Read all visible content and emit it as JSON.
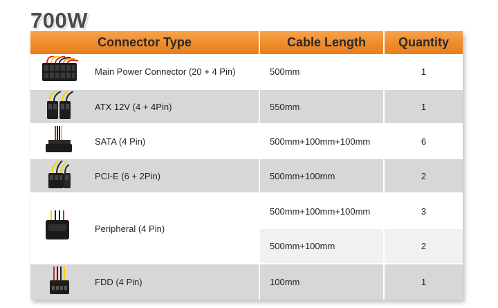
{
  "title": "700W",
  "headers": {
    "connector_type": "Connector Type",
    "cable_length": "Cable Length",
    "quantity": "Quantity"
  },
  "rows": [
    {
      "connector": "Main Power Connector (20 + 4 Pin)",
      "icon": "main-power-connector-icon",
      "lengths": [
        {
          "length": "500mm",
          "qty": "1"
        }
      ]
    },
    {
      "connector": "ATX 12V (4 + 4Pin)",
      "icon": "atx12v-connector-icon",
      "lengths": [
        {
          "length": "550mm",
          "qty": "1"
        }
      ]
    },
    {
      "connector": "SATA (4 Pin)",
      "icon": "sata-connector-icon",
      "lengths": [
        {
          "length": "500mm+100mm+100mm",
          "qty": "6"
        }
      ]
    },
    {
      "connector": "PCI-E (6 + 2Pin)",
      "icon": "pcie-connector-icon",
      "lengths": [
        {
          "length": "500mm+100mm",
          "qty": "2"
        }
      ]
    },
    {
      "connector": "Peripheral (4 Pin)",
      "icon": "peripheral-connector-icon",
      "lengths": [
        {
          "length": "500mm+100mm+100mm",
          "qty": "3"
        },
        {
          "length": "500mm+100mm",
          "qty": "2"
        }
      ]
    },
    {
      "connector": "FDD (4 Pin)",
      "icon": "fdd-connector-icon",
      "lengths": [
        {
          "length": "100mm",
          "qty": "1"
        }
      ]
    }
  ],
  "colors": {
    "header": "#ee8a2a",
    "row_gray": "#d7d7d7",
    "row_white": "#ffffff"
  }
}
